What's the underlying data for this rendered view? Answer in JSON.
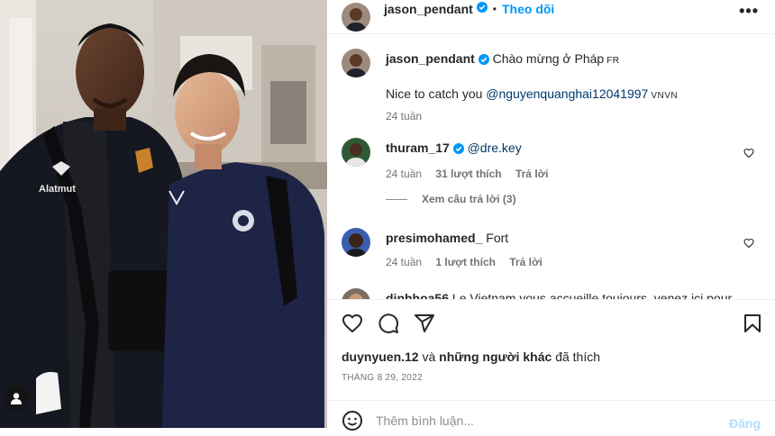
{
  "post": {
    "author": "jason_pendant",
    "follow_label": "Theo dõi",
    "more_label": "•••",
    "photo_jersey_text": "Alatmut"
  },
  "comments": [
    {
      "user": "jason_pendant",
      "verified": true,
      "text": "Chào mừng ở Pháp",
      "flag": "FR",
      "line2": "Nice to catch you",
      "mention": "@nguyenquanghai12041997",
      "flag2": "VNVN",
      "time": "24 tuần"
    },
    {
      "user": "thuram_17",
      "verified": true,
      "mention": "@dre.key",
      "time": "24 tuần",
      "likes": "31 lượt thích",
      "reply": "Trả lời",
      "view_replies": "Xem câu trả lời (3)"
    },
    {
      "user": "presimohamed_",
      "text": "Fort",
      "time": "24 tuần",
      "likes": "1 lượt thích",
      "reply": "Trả lời"
    },
    {
      "user": "dinhhoa56",
      "text": "Le Vietnam vous accueille toujours, venez ici pour"
    }
  ],
  "actions": {
    "icons": [
      "heart-icon",
      "comment-icon",
      "share-icon",
      "bookmark-icon"
    ]
  },
  "likes": {
    "first_user": "duynyuen.12",
    "connector": "và",
    "others": "những người khác",
    "suffix": "đã thích"
  },
  "date": "THÁNG 8 29, 2022",
  "add_comment": {
    "placeholder": "Thêm bình luận...",
    "post_label": "Đăng",
    "icon": "emoji-icon"
  },
  "colors": {
    "accent": "#0095f6",
    "verified": "#0095f6",
    "mention": "#00376b",
    "muted": "#737373"
  }
}
